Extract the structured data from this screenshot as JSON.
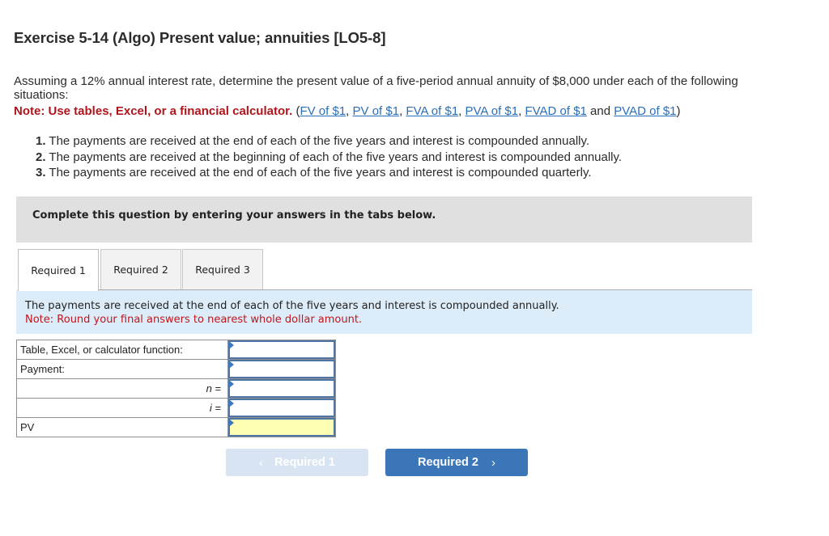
{
  "header": {
    "title": "Exercise 5-14 (Algo) Present value; annuities [LO5-8]"
  },
  "problem": {
    "intro": "Assuming a 12% annual interest rate, determine the present value of a five-period annual annuity of $8,000 under each of the following situations:",
    "note_label": "Note: Use tables, Excel, or a financial calculator.",
    "links": [
      "FV of $1",
      "PV of $1",
      "FVA of $1",
      "PVA of $1",
      "FVAD of $1",
      "PVAD of $1"
    ],
    "link_sep": ", ",
    "link_and": " and ",
    "open_paren": " (",
    "close_paren": ")",
    "situations": [
      {
        "num": "1.",
        "text": " The payments are received at the end of each of the five years and interest is compounded annually."
      },
      {
        "num": "2.",
        "text": " The payments are received at the beginning of each of the five years and interest is compounded annually."
      },
      {
        "num": "3.",
        "text": " The payments are received at the end of each of the five years and interest is compounded quarterly."
      }
    ]
  },
  "banner": {
    "text": "Complete this question by entering your answers in the tabs below."
  },
  "tabs": [
    {
      "label": "Required 1",
      "active": true
    },
    {
      "label": "Required 2",
      "active": false
    },
    {
      "label": "Required 3",
      "active": false
    }
  ],
  "required1": {
    "instruction": "The payments are received at the end of each of the five years and interest is compounded annually.",
    "note": "Note: Round your final answers to nearest whole dollar amount.",
    "rows": [
      {
        "label": "Table, Excel, or calculator function:",
        "value": ""
      },
      {
        "label": "Payment:",
        "value": ""
      },
      {
        "label": "n =",
        "value": ""
      },
      {
        "label": "i =",
        "value": ""
      },
      {
        "label": "PV",
        "value": ""
      }
    ]
  },
  "nav": {
    "prev_label": "Required 1",
    "next_label": "Required 2",
    "prev_icon": "‹",
    "next_icon": "›"
  },
  "colors": {
    "note_red": "#b0151c",
    "link_blue": "#2a6eb8",
    "button_blue": "#3b77b8",
    "button_disabled": "#d8e4f2",
    "info_bg": "#dcecf8",
    "answer_yellow": "#ffffb3"
  }
}
